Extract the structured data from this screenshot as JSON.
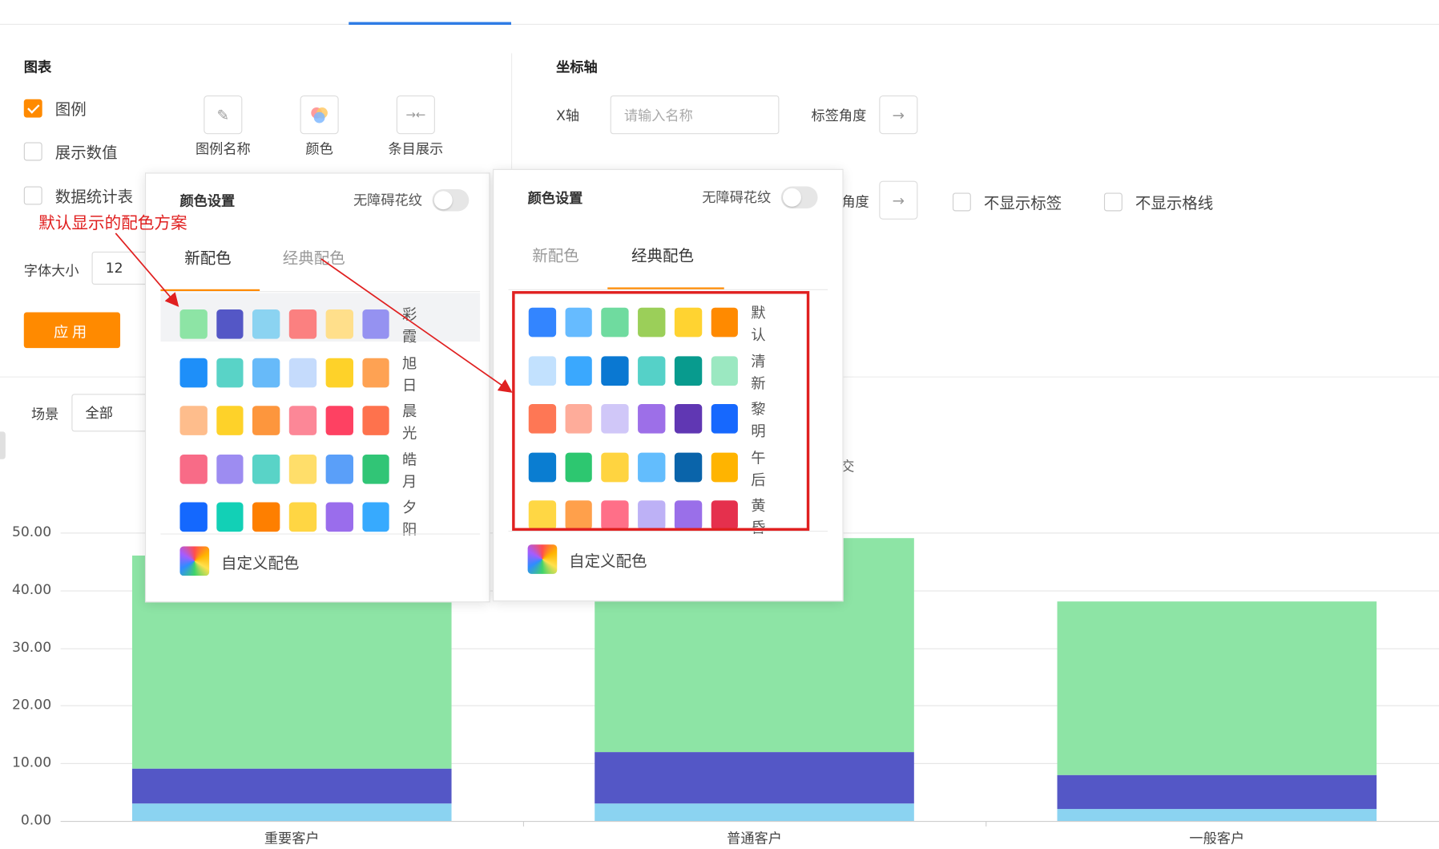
{
  "chart_panel": {
    "title": "图表",
    "legend_checkbox": {
      "label": "图例",
      "checked": true
    },
    "show_values_checkbox": {
      "label": "展示数值",
      "checked": false
    },
    "stats_table_checkbox": {
      "label": "数据统计表",
      "checked": false
    },
    "tools": [
      {
        "label": "图例名称",
        "icon": "pencil-icon",
        "glyph": "✎"
      },
      {
        "label": "颜色",
        "icon": "palette-icon",
        "glyph": ""
      },
      {
        "label": "条目展示",
        "icon": "collapse-arrows-icon",
        "glyph": "→←"
      }
    ],
    "font_size_label": "字体大小",
    "font_size_value": "12",
    "apply_button": "应用"
  },
  "axis_panel": {
    "title": "坐标轴",
    "x_axis_label": "X轴",
    "x_axis_placeholder": "请输入名称",
    "label_angle": "标签角度",
    "label_angle_2": "角度",
    "hide_labels": "不显示标签",
    "hide_gridlines": "不显示格线"
  },
  "filter": {
    "scene_label": "场景",
    "scene_value": "全部",
    "partial_text": "交"
  },
  "annotation": "默认显示的配色方案",
  "color_popup_new": {
    "title": "颜色设置",
    "accessibility_label": "无障碍花纹",
    "tabs": [
      "新配色",
      "经典配色"
    ],
    "active_tab": 0,
    "palettes": [
      {
        "name": "彩霞",
        "colors": [
          "#8de4a5",
          "#5457c6",
          "#8bd3f1",
          "#fb8080",
          "#ffdf8b",
          "#9592f1"
        ]
      },
      {
        "name": "旭日",
        "colors": [
          "#1e8ff9",
          "#59d3c7",
          "#67baf9",
          "#c5dbfc",
          "#fed229",
          "#fea253"
        ]
      },
      {
        "name": "晨光",
        "colors": [
          "#febd8c",
          "#fed229",
          "#fd963d",
          "#fc8797",
          "#fe4162",
          "#fe724d"
        ]
      },
      {
        "name": "皓月",
        "colors": [
          "#f86b87",
          "#9d8cf1",
          "#59d3c7",
          "#ffde6a",
          "#5a9ff9",
          "#31c576"
        ]
      },
      {
        "name": "夕阳",
        "colors": [
          "#1468fe",
          "#12d0b6",
          "#fe7f00",
          "#ffd643",
          "#9a6dec",
          "#37aafe"
        ]
      }
    ],
    "custom_label": "自定义配色"
  },
  "color_popup_classic": {
    "title": "颜色设置",
    "accessibility_label": "无障碍花纹",
    "tabs": [
      "新配色",
      "经典配色"
    ],
    "active_tab": 1,
    "palettes": [
      {
        "name": "默认",
        "colors": [
          "#3385ff",
          "#66bbff",
          "#6fdb9f",
          "#9bcf59",
          "#ffd331",
          "#ff8a00"
        ]
      },
      {
        "name": "清新",
        "colors": [
          "#c2e1fe",
          "#3aa8fe",
          "#0a78d2",
          "#55d1c8",
          "#089b8e",
          "#9be8c1"
        ]
      },
      {
        "name": "黎明",
        "colors": [
          "#fe7755",
          "#feac9a",
          "#d0c7f8",
          "#9d6fe8",
          "#6037b3",
          "#1668fe"
        ]
      },
      {
        "name": "午后",
        "colors": [
          "#0a7dd1",
          "#2dc770",
          "#ffd440",
          "#63bdfd",
          "#0a64aa",
          "#ffb400"
        ]
      },
      {
        "name": "黄昏",
        "colors": [
          "#ffd744",
          "#ffa04b",
          "#ff6f88",
          "#bdb1f6",
          "#9a6fe9",
          "#e5304d"
        ]
      }
    ],
    "custom_label": "自定义配色"
  },
  "chart_data": {
    "type": "bar",
    "stacked": true,
    "categories": [
      "重要客户",
      "普通客户",
      "一般客户"
    ],
    "series": [
      {
        "color": "#8bd3f1",
        "values": [
          3,
          3,
          2
        ]
      },
      {
        "color": "#5457c6",
        "values": [
          6,
          9,
          6
        ]
      },
      {
        "color": "#8de4a5",
        "values": [
          37,
          37,
          30
        ]
      }
    ],
    "ylim": [
      0,
      50
    ],
    "yticks": [
      "0.00",
      "10.00",
      "20.00",
      "30.00",
      "40.00",
      "50.00"
    ],
    "grid": true
  }
}
